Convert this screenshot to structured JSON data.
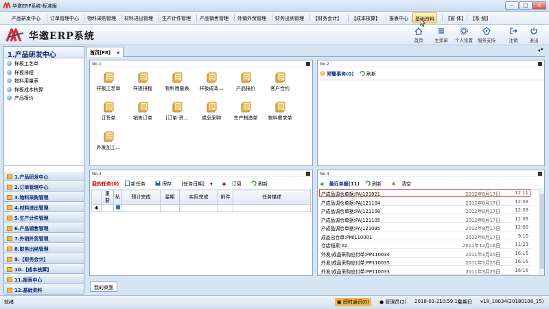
{
  "window": {
    "title": "华邀ERP系统-标准版"
  },
  "menu": [
    "产品研发中心",
    "订单管理中心",
    "物料采购管理",
    "材料进出管理",
    "生产计件管理",
    "产品销售管理",
    "外销外贸管理",
    "财务出纳管理",
    "【财务会计】",
    "【成本核算】",
    "报表中心",
    "基础资料",
    "【窗 体】",
    "【系 统】"
  ],
  "menu_active_index": 11,
  "header": {
    "app_title": "华邀ERP系统",
    "toolbar": [
      {
        "label": "首页",
        "icon": "home-icon"
      },
      {
        "label": "主菜单",
        "icon": "menu-icon"
      },
      {
        "label": "个人设置",
        "icon": "gear-icon"
      },
      {
        "label": "服务支持",
        "icon": "support-icon"
      },
      {
        "label": "注销",
        "icon": "logout-icon"
      },
      {
        "label": "退出",
        "icon": "power-icon"
      }
    ]
  },
  "sidebar": {
    "title": "1.产品研发中心",
    "items": [
      "样板工艺单",
      "样板排程",
      "物料用量表",
      "样板成本核算",
      "产品报价"
    ],
    "groups": [
      "1.产品研发中心",
      "2.订单管理中心",
      "3.物料采购管理",
      "4.材料进出管理",
      "5.生产计件管理",
      "6.产品销售管理",
      "7.外销外贸管理",
      "8.财务出纳管理",
      "9.【财务会计】",
      "10.【成本核算】",
      "11.报表中心",
      "12.基础资料"
    ]
  },
  "tabs": {
    "home": "首页[F8]",
    "close": "×",
    "desktop": "我的桌面"
  },
  "panel1": {
    "title": "No.1",
    "icons": [
      "样板工艺单",
      "样板排程",
      "物料用量表",
      "样板成本…",
      "产品报价",
      "客户合约",
      "订货单",
      "销售订单",
      "[订单-资…",
      "成品采购",
      "生产制造单",
      "物料需求单",
      "外发加工…"
    ]
  },
  "panel2": {
    "title": "No.2",
    "pending": "预警事务(0)",
    "refresh": "刷新"
  },
  "panel3": {
    "title": "No.3",
    "my_tasks": "我的任务(0)",
    "new_task": "新任务",
    "save": "保存",
    "task_date": "[任务日期]",
    "subscribe": "订阅",
    "refresh": "刷新",
    "columns": [
      "重要",
      "私",
      "预计完成",
      "星期",
      "实际完成",
      "附件",
      "任务描述"
    ],
    "new_row_marker": "✱"
  },
  "panel4": {
    "title": "No.4",
    "recent": "最近单据(11)",
    "refresh": "刷新",
    "clear": "清空",
    "rows": [
      {
        "name": "产成品调仓单据:PAJ121021",
        "date": "2012年8月17日",
        "time": "12:11"
      },
      {
        "name": "产成品调仓单据:PAJ121104",
        "date": "2012年8月17日",
        "time": "12:09"
      },
      {
        "name": "产成品调仓单据:PAJ121108",
        "date": "2012年8月17日",
        "time": "12:08"
      },
      {
        "name": "产成品调仓单据:PAJ121105",
        "date": "2012年8月17日",
        "time": "12:08"
      },
      {
        "name": "产成品调仓单据:PAJ121095",
        "date": "2012年8月17日",
        "time": "12:06"
      },
      {
        "name": "成品出仓单:PMI110001",
        "date": "2012年8月17日",
        "time": "9:10"
      },
      {
        "name": "仓店档案:02",
        "date": "2011年12月16日",
        "time": "11:29"
      },
      {
        "name": "外发/成品采购应付单:PP110034",
        "date": "2011年3月25日",
        "time": "16:16"
      },
      {
        "name": "外发/成品采购应付单:PP110035",
        "date": "2011年3月25日",
        "time": "16:16"
      },
      {
        "name": "外发/成品采购应付单:PP110033",
        "date": "2011年3月25日",
        "time": "16:16"
      }
    ]
  },
  "status": {
    "ready": "就绪",
    "im": "即时通讯(0)",
    "user": "管理员(2)",
    "date": "2018-01-21",
    "time": "10:59:16",
    "weekday": "星期日",
    "version": "v18_18034(20180108_15)"
  },
  "colors": {
    "accent": "#0b2f88",
    "highlight": "#ffd97a",
    "alert": "#cc0000"
  }
}
